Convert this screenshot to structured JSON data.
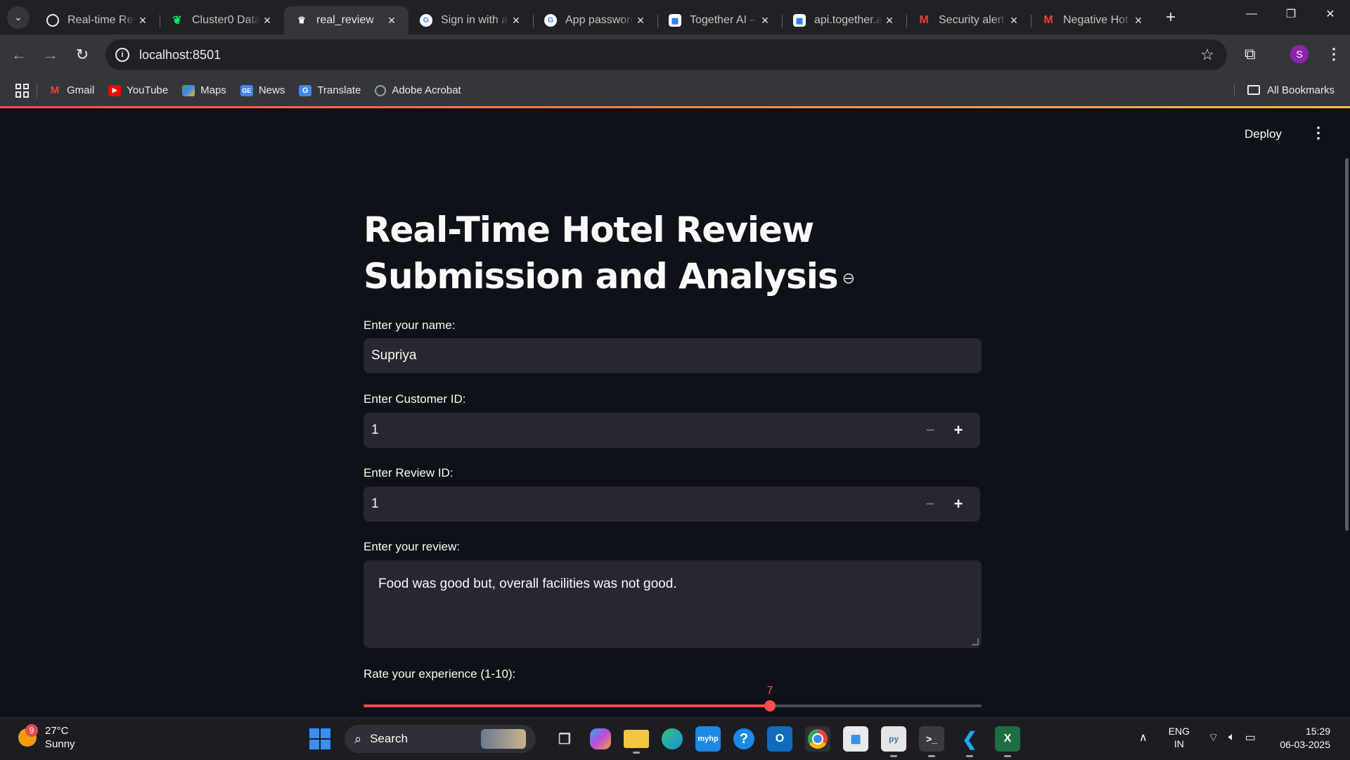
{
  "browser": {
    "tabs": [
      {
        "title": "Real-time Review",
        "fav_color": "#e8eaed",
        "icon": "openai-icon"
      },
      {
        "title": "Cluster0 Data",
        "fav_color": "#00ed64",
        "icon": "mongodb-leaf-icon"
      },
      {
        "title": "real_review",
        "fav_color": "#ffffff",
        "icon": "streamlit-crown-icon",
        "active": true
      },
      {
        "title": "Sign in with a",
        "fav_color": "#4285f4",
        "icon": "google-g-icon"
      },
      {
        "title": "App password",
        "fav_color": "#4285f4",
        "icon": "google-g-icon"
      },
      {
        "title": "Together AI –",
        "fav_color": "#1a73e8",
        "icon": "together-ai-icon"
      },
      {
        "title": "api.together.a",
        "fav_color": "#1a73e8",
        "icon": "together-ai-icon"
      },
      {
        "title": "Security alert",
        "fav_color": "#ea4335",
        "icon": "gmail-icon"
      },
      {
        "title": "Negative Hot",
        "fav_color": "#ea4335",
        "icon": "gmail-icon"
      }
    ],
    "url": "localhost:8501",
    "profile_initial": "S",
    "bookmarks": [
      {
        "label": "Gmail",
        "color": "#ea4335",
        "icon": "gmail-icon"
      },
      {
        "label": "YouTube",
        "color": "#ff0000",
        "icon": "youtube-icon"
      },
      {
        "label": "Maps",
        "color": "#34a853",
        "icon": "maps-icon"
      },
      {
        "label": "News",
        "color": "#4285f4",
        "icon": "news-icon"
      },
      {
        "label": "Translate",
        "color": "#4285f4",
        "icon": "translate-icon"
      },
      {
        "label": "Adobe Acrobat",
        "color": "#9aa0a6",
        "icon": "globe-icon"
      }
    ],
    "all_bookmarks": "All Bookmarks"
  },
  "app": {
    "deploy_label": "Deploy",
    "title": "Real-Time Hotel Review Submission and Analysis",
    "name_label": "Enter your name:",
    "name_value": "Supriya",
    "customer_id_label": "Enter Customer ID:",
    "customer_id_value": "1",
    "review_id_label": "Enter Review ID:",
    "review_id_value": "1",
    "review_label": "Enter your review:",
    "review_value": "Food was good but, overall facilities was not good.",
    "rating_label": "Rate your experience (1-10):",
    "rating_value": 7,
    "rating_min": 1,
    "rating_max": 10,
    "accent_color": "#ff4b4b"
  },
  "taskbar": {
    "weather_temp": "27°C",
    "weather_cond": "Sunny",
    "weather_badge": "9",
    "search_label": "Search",
    "lang_1": "ENG",
    "lang_2": "IN",
    "time": "15:29",
    "date": "06-03-2025",
    "apps": [
      "task-view-icon",
      "copilot-icon",
      "file-explorer-icon",
      "edge-icon",
      "myhp-icon",
      "help-icon",
      "outlook-icon",
      "chrome-icon",
      "store-icon",
      "python-file-icon",
      "terminal-icon",
      "vscode-icon",
      "excel-icon"
    ]
  }
}
